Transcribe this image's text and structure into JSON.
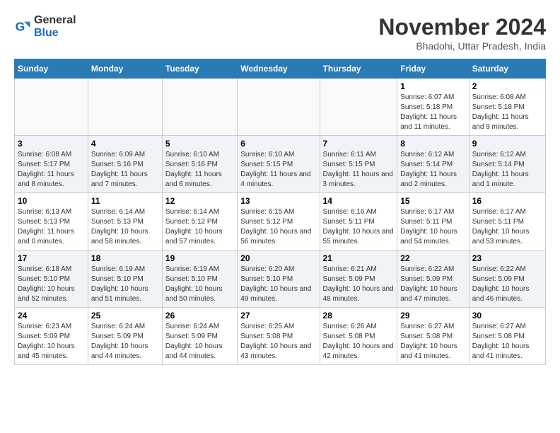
{
  "logo": {
    "general": "General",
    "blue": "Blue"
  },
  "title": "November 2024",
  "subtitle": "Bhadohi, Uttar Pradesh, India",
  "headers": [
    "Sunday",
    "Monday",
    "Tuesday",
    "Wednesday",
    "Thursday",
    "Friday",
    "Saturday"
  ],
  "weeks": [
    [
      {
        "day": "",
        "empty": true
      },
      {
        "day": "",
        "empty": true
      },
      {
        "day": "",
        "empty": true
      },
      {
        "day": "",
        "empty": true
      },
      {
        "day": "",
        "empty": true
      },
      {
        "day": "1",
        "sunrise": "6:07 AM",
        "sunset": "5:18 PM",
        "daylight": "11 hours and 11 minutes."
      },
      {
        "day": "2",
        "sunrise": "6:08 AM",
        "sunset": "5:18 PM",
        "daylight": "11 hours and 9 minutes."
      }
    ],
    [
      {
        "day": "3",
        "sunrise": "6:08 AM",
        "sunset": "5:17 PM",
        "daylight": "11 hours and 8 minutes."
      },
      {
        "day": "4",
        "sunrise": "6:09 AM",
        "sunset": "5:16 PM",
        "daylight": "11 hours and 7 minutes."
      },
      {
        "day": "5",
        "sunrise": "6:10 AM",
        "sunset": "5:16 PM",
        "daylight": "11 hours and 6 minutes."
      },
      {
        "day": "6",
        "sunrise": "6:10 AM",
        "sunset": "5:15 PM",
        "daylight": "11 hours and 4 minutes."
      },
      {
        "day": "7",
        "sunrise": "6:11 AM",
        "sunset": "5:15 PM",
        "daylight": "11 hours and 3 minutes."
      },
      {
        "day": "8",
        "sunrise": "6:12 AM",
        "sunset": "5:14 PM",
        "daylight": "11 hours and 2 minutes."
      },
      {
        "day": "9",
        "sunrise": "6:12 AM",
        "sunset": "5:14 PM",
        "daylight": "11 hours and 1 minute."
      }
    ],
    [
      {
        "day": "10",
        "sunrise": "6:13 AM",
        "sunset": "5:13 PM",
        "daylight": "11 hours and 0 minutes."
      },
      {
        "day": "11",
        "sunrise": "6:14 AM",
        "sunset": "5:13 PM",
        "daylight": "10 hours and 58 minutes."
      },
      {
        "day": "12",
        "sunrise": "6:14 AM",
        "sunset": "5:12 PM",
        "daylight": "10 hours and 57 minutes."
      },
      {
        "day": "13",
        "sunrise": "6:15 AM",
        "sunset": "5:12 PM",
        "daylight": "10 hours and 56 minutes."
      },
      {
        "day": "14",
        "sunrise": "6:16 AM",
        "sunset": "5:11 PM",
        "daylight": "10 hours and 55 minutes."
      },
      {
        "day": "15",
        "sunrise": "6:17 AM",
        "sunset": "5:11 PM",
        "daylight": "10 hours and 54 minutes."
      },
      {
        "day": "16",
        "sunrise": "6:17 AM",
        "sunset": "5:11 PM",
        "daylight": "10 hours and 53 minutes."
      }
    ],
    [
      {
        "day": "17",
        "sunrise": "6:18 AM",
        "sunset": "5:10 PM",
        "daylight": "10 hours and 52 minutes."
      },
      {
        "day": "18",
        "sunrise": "6:19 AM",
        "sunset": "5:10 PM",
        "daylight": "10 hours and 51 minutes."
      },
      {
        "day": "19",
        "sunrise": "6:19 AM",
        "sunset": "5:10 PM",
        "daylight": "10 hours and 50 minutes."
      },
      {
        "day": "20",
        "sunrise": "6:20 AM",
        "sunset": "5:10 PM",
        "daylight": "10 hours and 49 minutes."
      },
      {
        "day": "21",
        "sunrise": "6:21 AM",
        "sunset": "5:09 PM",
        "daylight": "10 hours and 48 minutes."
      },
      {
        "day": "22",
        "sunrise": "6:22 AM",
        "sunset": "5:09 PM",
        "daylight": "10 hours and 47 minutes."
      },
      {
        "day": "23",
        "sunrise": "6:22 AM",
        "sunset": "5:09 PM",
        "daylight": "10 hours and 46 minutes."
      }
    ],
    [
      {
        "day": "24",
        "sunrise": "6:23 AM",
        "sunset": "5:09 PM",
        "daylight": "10 hours and 45 minutes."
      },
      {
        "day": "25",
        "sunrise": "6:24 AM",
        "sunset": "5:09 PM",
        "daylight": "10 hours and 44 minutes."
      },
      {
        "day": "26",
        "sunrise": "6:24 AM",
        "sunset": "5:09 PM",
        "daylight": "10 hours and 44 minutes."
      },
      {
        "day": "27",
        "sunrise": "6:25 AM",
        "sunset": "5:08 PM",
        "daylight": "10 hours and 43 minutes."
      },
      {
        "day": "28",
        "sunrise": "6:26 AM",
        "sunset": "5:08 PM",
        "daylight": "10 hours and 42 minutes."
      },
      {
        "day": "29",
        "sunrise": "6:27 AM",
        "sunset": "5:08 PM",
        "daylight": "10 hours and 41 minutes."
      },
      {
        "day": "30",
        "sunrise": "6:27 AM",
        "sunset": "5:08 PM",
        "daylight": "10 hours and 41 minutes."
      }
    ]
  ]
}
